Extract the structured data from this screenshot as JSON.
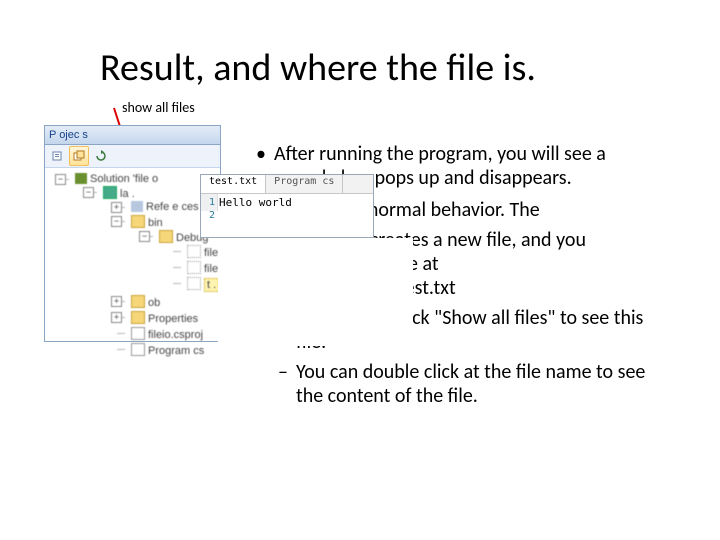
{
  "title": "Result, and where the file is.",
  "annotation": "show all files",
  "solutionExplorer": {
    "header": "P ojec s",
    "toolbar": {
      "btn1": "properties-icon",
      "btn2": "show-all-files-icon",
      "btn3": "refresh-icon"
    },
    "tree": {
      "root": "Solution 'file o",
      "proj": "la .",
      "refs": "Refe e ces",
      "bin": "bin",
      "debug": "Debug",
      "f1": "fileio exe",
      "f2": "fileio pdb",
      "f3": "t   . ",
      "obj": "ob",
      "props": "Properties",
      "csproj": "fileio.csproj",
      "prog": "Program cs"
    }
  },
  "editor": {
    "tab1": "test.txt",
    "tab2": "Program cs",
    "gut1": "1",
    "gut2": "2",
    "line1": "Hello world"
  },
  "body": {
    "p1": "After running the program, you will see a console box pops up and disappears.",
    "p2a": "That is a normal behavior.  The",
    "p2b": "program creates a new file, and you",
    "p2c": "can see the file at",
    "p2d": "/bin/Debug/test.txt",
    "p3": "You have to click \"Show all files\" to see this file.",
    "p4": "You can double click at the file name to see the content of the file."
  }
}
